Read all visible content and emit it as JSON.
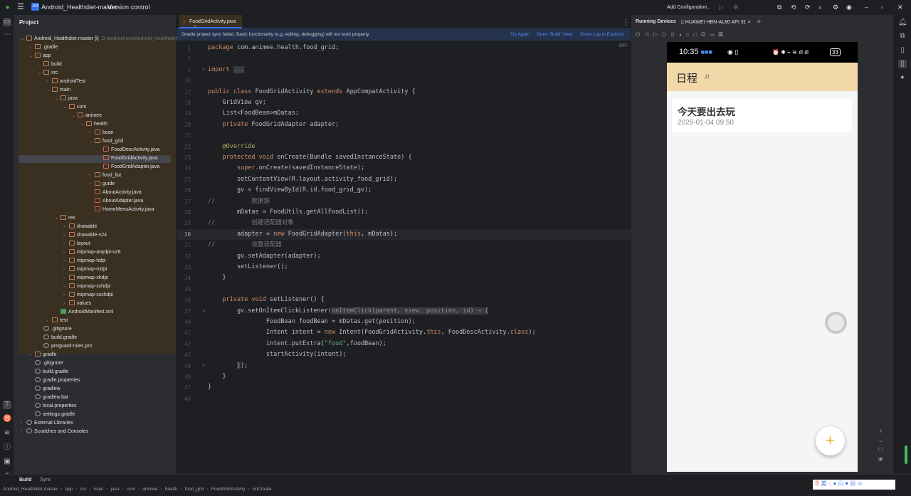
{
  "titlebar": {
    "project": "Android_Healthdiet-master",
    "vcs": "Version control",
    "config": "Add Configuration...",
    "app_badge": "AH"
  },
  "project_panel": {
    "title": "Project",
    "root_hint": "D:\\android pro\\Android_Healthdiet-ma",
    "items": [
      {
        "label": "Android_Healthdiet-master [i]",
        "level": 0,
        "type": "folder",
        "arrow": "v"
      },
      {
        "label": ".gradle",
        "level": 1,
        "type": "folder",
        "arrow": ">"
      },
      {
        "label": "app",
        "level": 1,
        "type": "folder",
        "arrow": "v"
      },
      {
        "label": "build",
        "level": 2,
        "type": "folder",
        "arrow": ">"
      },
      {
        "label": "src",
        "level": 2,
        "type": "folder",
        "arrow": "v"
      },
      {
        "label": "androidTest",
        "level": 3,
        "type": "folder",
        "arrow": ">"
      },
      {
        "label": "main",
        "level": 3,
        "type": "folder",
        "arrow": "v"
      },
      {
        "label": "java",
        "level": 4,
        "type": "folder",
        "arrow": "v"
      },
      {
        "label": "com",
        "level": 5,
        "type": "folder",
        "arrow": "v"
      },
      {
        "label": "animee",
        "level": 6,
        "type": "folder",
        "arrow": "v"
      },
      {
        "label": "health",
        "level": 7,
        "type": "folder",
        "arrow": "v"
      },
      {
        "label": "bean",
        "level": 8,
        "type": "folder",
        "arrow": ">"
      },
      {
        "label": "food_grid",
        "level": 8,
        "type": "folder",
        "arrow": "v"
      },
      {
        "label": "FoodDescActivity.java",
        "level": 9,
        "type": "file",
        "arrow": ""
      },
      {
        "label": "FoodGridActivity.java",
        "level": 9,
        "type": "file",
        "arrow": "",
        "selected": true
      },
      {
        "label": "FoodGridAdapter.java",
        "level": 9,
        "type": "file",
        "arrow": ""
      },
      {
        "label": "food_list",
        "level": 8,
        "type": "folder",
        "arrow": ">"
      },
      {
        "label": "guide",
        "level": 8,
        "type": "folder",
        "arrow": ">"
      },
      {
        "label": "AboutActivity.java",
        "level": 8,
        "type": "file",
        "arrow": ""
      },
      {
        "label": "AboutAdapter.java",
        "level": 8,
        "type": "file",
        "arrow": ""
      },
      {
        "label": "HomeMenuActivity.java",
        "level": 8,
        "type": "file",
        "arrow": ""
      },
      {
        "label": "res",
        "level": 4,
        "type": "folder",
        "arrow": "v"
      },
      {
        "label": "drawable",
        "level": 5,
        "type": "folder",
        "arrow": ">"
      },
      {
        "label": "drawable-v24",
        "level": 5,
        "type": "folder",
        "arrow": ">"
      },
      {
        "label": "layout",
        "level": 5,
        "type": "folder",
        "arrow": ">"
      },
      {
        "label": "mipmap-anydpi-v26",
        "level": 5,
        "type": "folder",
        "arrow": ">"
      },
      {
        "label": "mipmap-hdpi",
        "level": 5,
        "type": "folder",
        "arrow": ">"
      },
      {
        "label": "mipmap-mdpi",
        "level": 5,
        "type": "folder",
        "arrow": ">"
      },
      {
        "label": "mipmap-xhdpi",
        "level": 5,
        "type": "folder",
        "arrow": ">"
      },
      {
        "label": "mipmap-xxhdpi",
        "level": 5,
        "type": "folder",
        "arrow": ">"
      },
      {
        "label": "mipmap-xxxhdpi",
        "level": 5,
        "type": "folder",
        "arrow": ">"
      },
      {
        "label": "values",
        "level": 5,
        "type": "folder",
        "arrow": ">"
      },
      {
        "label": "AndroidManifest.xml",
        "level": 4,
        "type": "xml",
        "arrow": ""
      },
      {
        "label": "test",
        "level": 3,
        "type": "folder",
        "arrow": ">"
      },
      {
        "label": ".gitignore",
        "level": 2,
        "type": "cfg",
        "arrow": ""
      },
      {
        "label": "build.gradle",
        "level": 2,
        "type": "cfg",
        "arrow": ""
      },
      {
        "label": "proguard-rules.pro",
        "level": 2,
        "type": "cfg",
        "arrow": ""
      },
      {
        "label": "gradle",
        "level": 1,
        "type": "folder",
        "arrow": ">"
      },
      {
        "label": ".gitignore",
        "level": 1,
        "type": "cfg",
        "arrow": ""
      },
      {
        "label": "build.gradle",
        "level": 1,
        "type": "cfg",
        "arrow": ""
      },
      {
        "label": "gradle.properties",
        "level": 1,
        "type": "cfg",
        "arrow": ""
      },
      {
        "label": "gradlew",
        "level": 1,
        "type": "cfg",
        "arrow": ""
      },
      {
        "label": "gradlew.bat",
        "level": 1,
        "type": "cfg",
        "arrow": ""
      },
      {
        "label": "local.properties",
        "level": 1,
        "type": "cfg",
        "arrow": ""
      },
      {
        "label": "settings.gradle",
        "level": 1,
        "type": "cfg",
        "arrow": ""
      },
      {
        "label": "External Libraries",
        "level": 0,
        "type": "cfg",
        "arrow": ">"
      },
      {
        "label": "Scratches and Consoles",
        "level": 0,
        "type": "cfg",
        "arrow": ">"
      }
    ]
  },
  "editor": {
    "tab": "FoodGridActivity.java",
    "banner": {
      "message": "Gradle project sync failed. Basic functionality (e.g. editing, debugging) will not work properly.",
      "try_again": "Try Again",
      "open_build": "Open 'Build' View",
      "show_log": "Show Log in Explorer"
    },
    "readonly_badge": "OFF",
    "current_line": "30",
    "lines": [
      {
        "n": "1",
        "t": [
          [
            "package",
            "kw"
          ],
          [
            " com.animee.health.food_grid;",
            ""
          ]
        ]
      },
      {
        "n": "2",
        "t": []
      },
      {
        "n": "3",
        "fold": ">",
        "t": [
          [
            "import",
            "kw"
          ],
          [
            " ",
            ""
          ],
          [
            "...",
            "fold"
          ]
        ]
      },
      {
        "n": "16",
        "t": []
      },
      {
        "n": "17",
        "t": [
          [
            "public class",
            "kw"
          ],
          [
            " FoodGridActivity ",
            ""
          ],
          [
            "extends",
            "kw"
          ],
          [
            " AppCompatActivity {",
            ""
          ]
        ]
      },
      {
        "n": "18",
        "t": [
          [
            "    GridView gv;",
            ""
          ]
        ]
      },
      {
        "n": "19",
        "t": [
          [
            "    List<FoodBean>mDatas;",
            ""
          ]
        ]
      },
      {
        "n": "20",
        "t": [
          [
            "    ",
            ""
          ],
          [
            "private",
            "kw"
          ],
          [
            " FoodGridAdapter adapter;",
            ""
          ]
        ]
      },
      {
        "n": "21",
        "t": []
      },
      {
        "n": "22",
        "t": [
          [
            "    @Override",
            "ann"
          ]
        ]
      },
      {
        "n": "23",
        "t": [
          [
            "    ",
            ""
          ],
          [
            "protected void",
            "kw"
          ],
          [
            " onCreate(Bundle savedInstanceState) {",
            ""
          ]
        ]
      },
      {
        "n": "24",
        "t": [
          [
            "        ",
            ""
          ],
          [
            "super",
            "kw"
          ],
          [
            ".onCreate(savedInstanceState);",
            ""
          ]
        ]
      },
      {
        "n": "25",
        "t": [
          [
            "        setContentView(R.layout.activity_food_grid);",
            ""
          ]
        ]
      },
      {
        "n": "26",
        "t": [
          [
            "        gv = findViewById(R.id.food_grid_gv);",
            ""
          ]
        ]
      },
      {
        "n": "27",
        "t": [
          [
            "//          数据源",
            "cmt"
          ]
        ]
      },
      {
        "n": "28",
        "t": [
          [
            "        mDatas = FoodUtils.getAllFoodList();",
            ""
          ]
        ]
      },
      {
        "n": "29",
        "t": [
          [
            "//          创建适配器对象",
            "cmt"
          ]
        ]
      },
      {
        "n": "30",
        "t": [
          [
            "        adapter = ",
            ""
          ],
          [
            "new",
            "kw"
          ],
          [
            " FoodGridAdapter(",
            ""
          ],
          [
            "this",
            "kw"
          ],
          [
            ", mDatas);",
            ""
          ]
        ]
      },
      {
        "n": "31",
        "t": [
          [
            "//          设置适配器",
            "cmt"
          ]
        ]
      },
      {
        "n": "32",
        "t": [
          [
            "        gv.setAdapter(adapter);",
            ""
          ]
        ]
      },
      {
        "n": "33",
        "t": [
          [
            "        setListener();",
            ""
          ]
        ]
      },
      {
        "n": "34",
        "t": [
          [
            "    }",
            ""
          ]
        ]
      },
      {
        "n": "35",
        "t": []
      },
      {
        "n": "36",
        "t": [
          [
            "    ",
            ""
          ],
          [
            "private void",
            "kw"
          ],
          [
            " setListener() {",
            ""
          ]
        ]
      },
      {
        "n": "37",
        "fold": ">",
        "t": [
          [
            "        gv.setOnItemClickListener(",
            ""
          ],
          [
            "onItemClick(parent, view, position, id) → {",
            "fold"
          ]
        ]
      },
      {
        "n": "40",
        "t": [
          [
            "                FoodBean foodBean = mDatas.get(position);",
            ""
          ]
        ]
      },
      {
        "n": "41",
        "t": [
          [
            "                Intent intent = ",
            ""
          ],
          [
            "new",
            "kw"
          ],
          [
            " Intent(FoodGridActivity.",
            ""
          ],
          [
            "this",
            "kw"
          ],
          [
            ", FoodDescActivity.",
            ""
          ],
          [
            "class",
            "kw"
          ],
          [
            ");",
            ""
          ]
        ]
      },
      {
        "n": "42",
        "t": [
          [
            "                intent.putExtra(",
            ""
          ],
          [
            "\"food\"",
            "str"
          ],
          [
            ",foodBean);",
            ""
          ]
        ]
      },
      {
        "n": "43",
        "t": [
          [
            "                startActivity(intent);",
            ""
          ]
        ]
      },
      {
        "n": "44",
        "fold": ">",
        "t": [
          [
            "        ",
            ""
          ],
          [
            "}",
            "fold"
          ],
          [
            ");",
            ""
          ]
        ]
      },
      {
        "n": "46",
        "t": [
          [
            "    }",
            ""
          ]
        ]
      },
      {
        "n": "47",
        "t": [
          [
            "}",
            ""
          ]
        ]
      },
      {
        "n": "48",
        "t": []
      }
    ]
  },
  "running_devices": {
    "title": "Running Devices",
    "device_tab": "HUAWEI HBN-AL80 API 31",
    "phone": {
      "time": "10:35",
      "battery": "33",
      "app_title": "日程",
      "card_title": "今天要出去玩",
      "card_time": "2025-01-04 09:50",
      "fab": "+"
    },
    "zoom_ratio": "1:1"
  },
  "bottom": {
    "build_tab": "Build",
    "sync_tab": "Sync",
    "breadcrumb": [
      "Android_Healthdiet-master",
      "app",
      "src",
      "main",
      "java",
      "com",
      "animee",
      "health",
      "food_grid",
      "FoodGridActivity",
      "onCreate"
    ]
  },
  "colors": {
    "accent": "#3574f0",
    "module_bg": "#3a3021",
    "banner_bg": "#25324d",
    "appbar": "#f3d9aa",
    "fab_plus": "#e8b923"
  }
}
